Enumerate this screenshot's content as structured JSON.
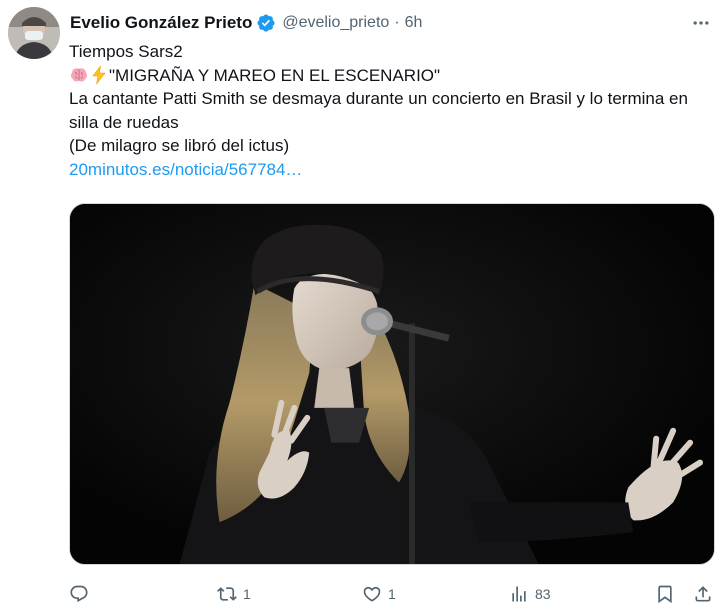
{
  "tweet": {
    "author": {
      "display_name": "Evelio González Prieto",
      "handle": "@evelio_prieto",
      "verified_icon": "verified-badge-icon",
      "avatar_icon": "user-avatar"
    },
    "separator": "·",
    "time": "6h",
    "more_icon": "more-dots-icon",
    "text": {
      "line1": "Tiempos Sars2",
      "line2_emojis": [
        "brain-emoji",
        "lightning-emoji"
      ],
      "line2": "\"MIGRAÑA Y MAREO EN EL ESCENARIO\"",
      "line3": "La cantante Patti Smith se desmaya durante un concierto en Brasil y lo termina en silla de ruedas",
      "line4": "(De milagro se libró del ictus)",
      "link": "20minutos.es/noticia/567784…"
    },
    "media": {
      "description_icon": "concert-photo"
    },
    "actions": {
      "reply_count": "",
      "retweet_count": "1",
      "like_count": "1",
      "views_count": "83"
    }
  },
  "colors": {
    "text": "#0f1419",
    "secondary": "#536471",
    "link": "#1d9bf0",
    "verified": "#1d9bf0"
  }
}
